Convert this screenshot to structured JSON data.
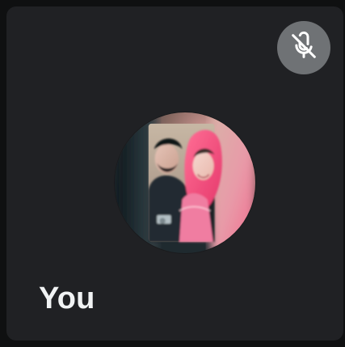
{
  "participant": {
    "name_label": "You"
  },
  "mic": {
    "icon": "mic-off-icon",
    "state": "muted"
  },
  "colors": {
    "tile_background": "#202124",
    "mic_button_background": "#6f7275",
    "label_text": "#f1f3f4"
  }
}
